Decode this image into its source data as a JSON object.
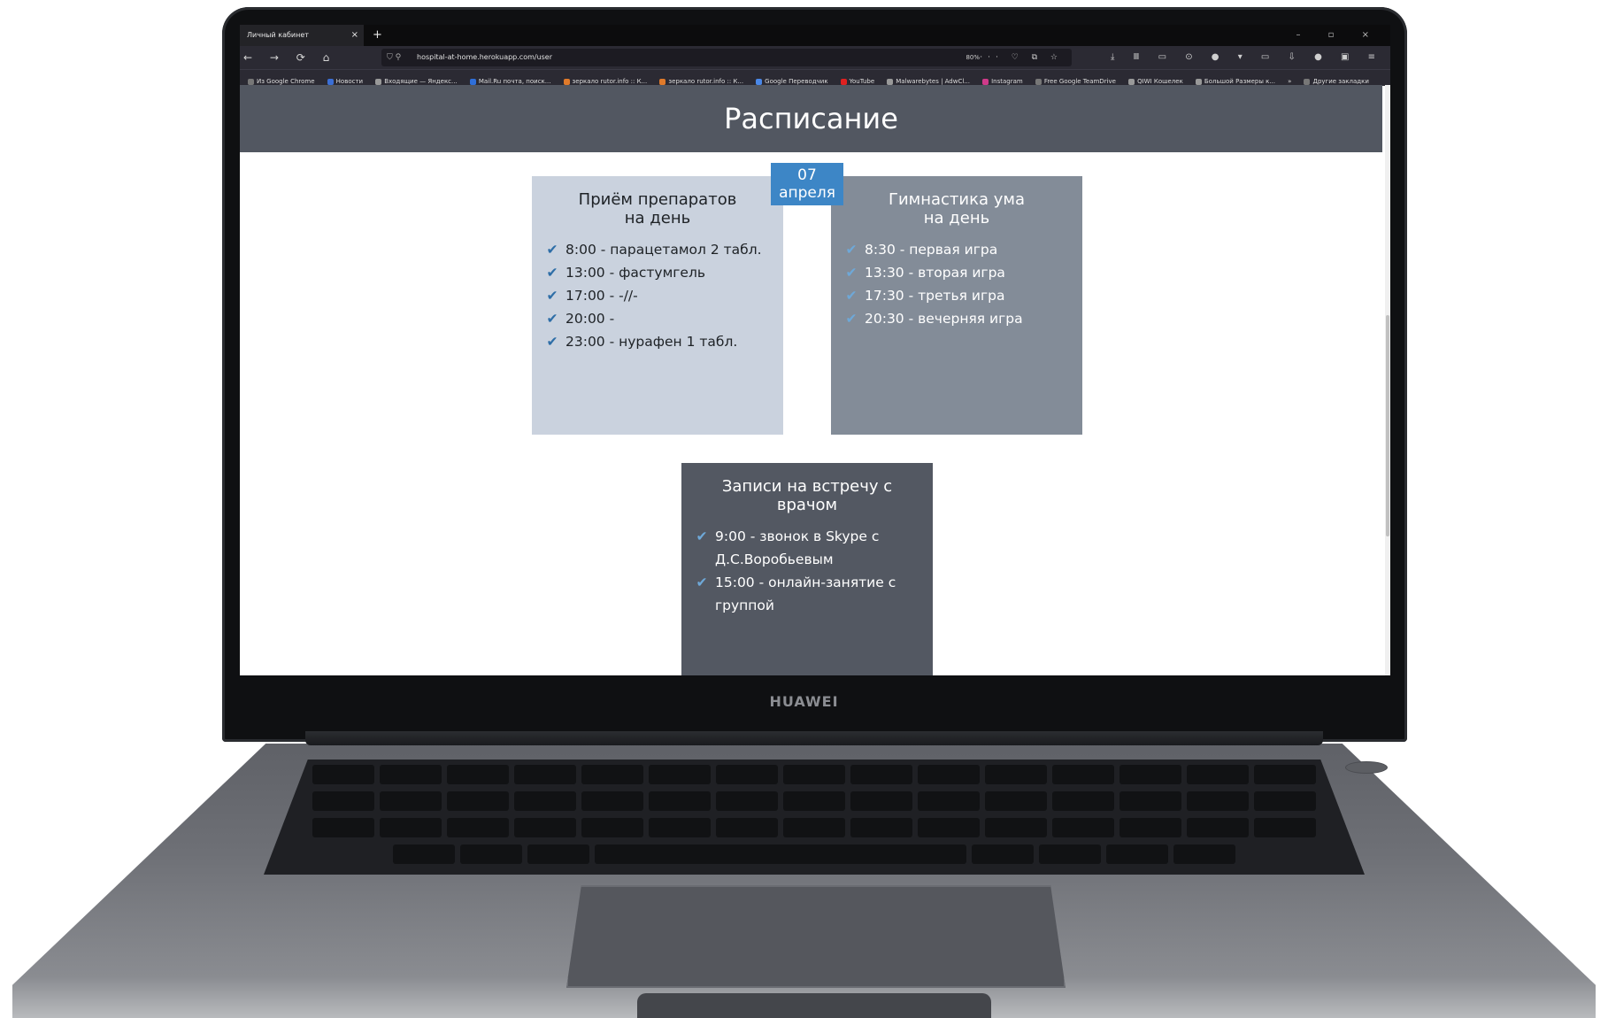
{
  "browser": {
    "tab_title": "Личный кабинет",
    "tab_close": "×",
    "new_tab": "+",
    "window_controls": "– ▫ ×",
    "nav_icons": "← → ⟳ ⌂",
    "url": "hospital-at-home.herokuapp.com/user",
    "zoom": "80%",
    "url_actions": "··· ♡ ⧉ ☆",
    "toolbar_icons": "⤓ Ⅲ ▭ ⊙ ● ▾ ▭ ⇩ ● ▣ ≡",
    "bookmarks": [
      "Из Google Chrome",
      "Новости",
      "Входящие — Яндекс...",
      "Mail.Ru почта, поиск...",
      "зеркало rutor.info :: К...",
      "зеркало rutor.info :: К...",
      "Google Переводчик",
      "YouTube",
      "Malwarebytes | AdwCl...",
      "Instagram",
      "Free Google TeamDrive",
      "QIWI Кошелек",
      "Большой Размеры к...",
      "»",
      "Другие закладки"
    ]
  },
  "page": {
    "title": "Расписание",
    "date_day": "07",
    "date_month": "апреля",
    "cards": [
      {
        "title_line1": "Приём препаратов",
        "title_line2": "на день",
        "items": [
          "8:00 - парацетамол 2 табл.",
          "13:00 - фастумгель",
          "17:00 - -//-",
          "20:00 -",
          "23:00 - нурафен 1 табл."
        ]
      },
      {
        "title_line1": "Гимнастика ума",
        "title_line2": "на день",
        "items": [
          "8:30 - первая игра",
          "13:30 - вторая игра",
          "17:30 - третья игра",
          "20:30 - вечерняя игра"
        ]
      },
      {
        "title_line1": "Записи на встречу с",
        "title_line2": "врачом",
        "items": [
          "9:00 - звонок в Skype с Д.С.Воробьевым",
          "15:00 - онлайн-занятие с группой"
        ]
      }
    ],
    "check_glyph": "✔"
  },
  "device": {
    "brand": "HUAWEI"
  },
  "colors": {
    "header_bg": "#525761",
    "date_badge": "#3d86c6",
    "card1_bg": "#cad2de",
    "card2_bg": "#838c98",
    "card3_bg": "#535862"
  }
}
